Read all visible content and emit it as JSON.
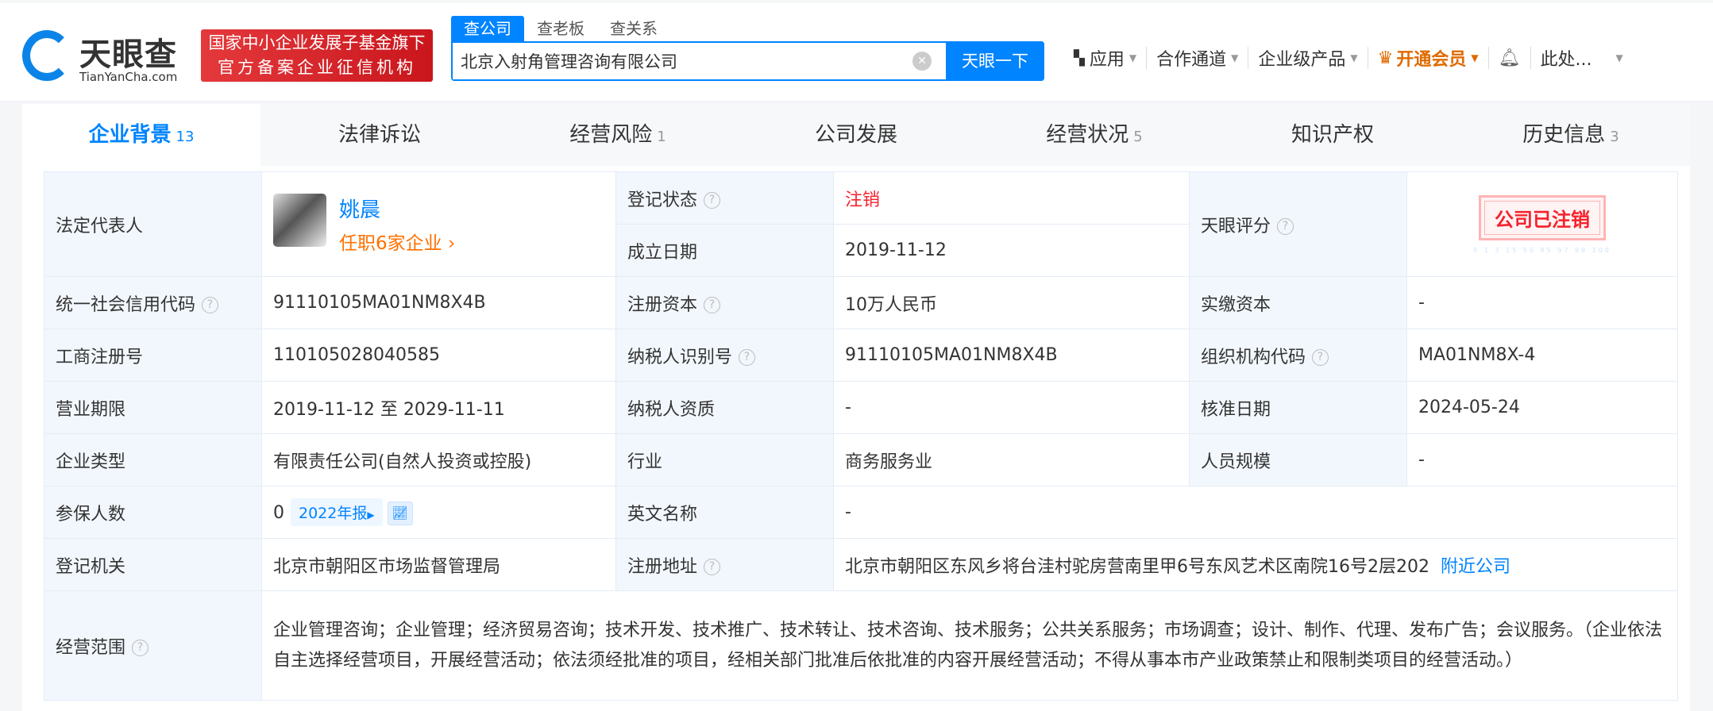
{
  "header": {
    "logo_name": "天眼查",
    "logo_domain": "TianYanCha.com",
    "badge_line1": "国家中小企业发展子基金旗下",
    "badge_line2": "官方备案企业征信机构",
    "search_tabs": [
      "查公司",
      "查老板",
      "查关系"
    ],
    "search_value": "北京入射角管理咨询有限公司",
    "search_button": "天眼一下",
    "nav": [
      "应用",
      "合作通道",
      "企业级产品",
      "开通会员",
      "此处..."
    ]
  },
  "tabs": [
    {
      "label": "企业背景",
      "count": "13"
    },
    {
      "label": "法律诉讼",
      "count": ""
    },
    {
      "label": "经营风险",
      "count": "1"
    },
    {
      "label": "公司发展",
      "count": ""
    },
    {
      "label": "经营状况",
      "count": "5"
    },
    {
      "label": "知识产权",
      "count": ""
    },
    {
      "label": "历史信息",
      "count": "3"
    }
  ],
  "info": {
    "legal_rep_label": "法定代表人",
    "legal_rep_name": "姚晨",
    "legal_rep_jobs": "任职6家企业",
    "reg_status_label": "登记状态",
    "reg_status": "注销",
    "found_date_label": "成立日期",
    "found_date": "2019-11-12",
    "score_label": "天眼评分",
    "stamp": "公司已注销",
    "score_scale": "0 1 3 15 50 85 97 99 100",
    "credit_code_label": "统一社会信用代码",
    "credit_code": "91110105MA01NM8X4B",
    "reg_capital_label": "注册资本",
    "reg_capital": "10万人民币",
    "paid_capital_label": "实缴资本",
    "paid_capital": "-",
    "biz_reg_no_label": "工商注册号",
    "biz_reg_no": "110105028040585",
    "taxpayer_id_label": "纳税人识别号",
    "taxpayer_id": "91110105MA01NM8X4B",
    "org_code_label": "组织机构代码",
    "org_code": "MA01NM8X-4",
    "term_label": "营业期限",
    "term": "2019-11-12 至 2029-11-11",
    "tax_qual_label": "纳税人资质",
    "tax_qual": "-",
    "approve_date_label": "核准日期",
    "approve_date": "2024-05-24",
    "type_label": "企业类型",
    "type": "有限责任公司(自然人投资或控股)",
    "industry_label": "行业",
    "industry": "商务服务业",
    "staff_label": "人员规模",
    "staff": "-",
    "insured_label": "参保人数",
    "insured": "0",
    "report": "2022年报",
    "en_name_label": "英文名称",
    "en_name": "-",
    "authority_label": "登记机关",
    "authority": "北京市朝阳区市场监督管理局",
    "address_label": "注册地址",
    "address": "北京市朝阳区东风乡将台洼村驼房营南里甲6号东风艺术区南院16号2层202",
    "nearby": "附近公司",
    "scope_label": "经营范围",
    "scope": "企业管理咨询；企业管理；经济贸易咨询；技术开发、技术推广、技术转让、技术咨询、技术服务；公共关系服务；市场调查；设计、制作、代理、发布广告；会议服务。（企业依法自主选择经营项目，开展经营活动；依法须经批准的项目，经相关部门批准后依批准的内容开展经营活动；不得从事本市产业政策禁止和限制类项目的经营活动。）"
  },
  "colors": {
    "accent": "#0084ff",
    "danger": "#f5222d",
    "vip": "#e06a00"
  }
}
